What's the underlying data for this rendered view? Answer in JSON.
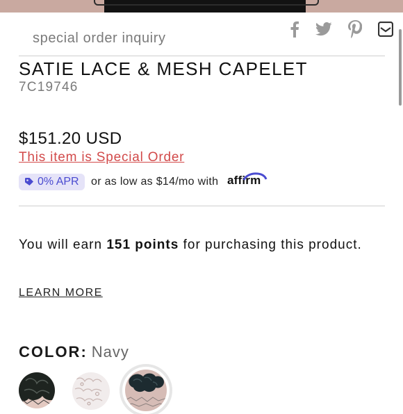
{
  "page": {
    "inquiry_label": "special order inquiry",
    "share_icons": [
      "facebook-icon",
      "twitter-icon",
      "pinterest-icon",
      "email-icon"
    ]
  },
  "product": {
    "title": "SATIE LACE & MESH CAPELET",
    "sku": "7C19746",
    "price": "$151.20 USD",
    "special_order": "This item is Special Order"
  },
  "financing": {
    "apr_badge": "0% APR",
    "text": "or as low as $14/mo with",
    "brand": "affirm",
    "brand_color": "#4a4bd0"
  },
  "rewards": {
    "prefix": "You will earn",
    "points": "151 points",
    "suffix": "for purchasing this product.",
    "learn_more": "LEARN MORE"
  },
  "color": {
    "label": "COLOR:",
    "selected": "Navy",
    "swatches": [
      "Black",
      "White",
      "Navy"
    ]
  },
  "accent": {
    "special_order": "#d24a4a",
    "apr_bg": "#e5e3f8"
  }
}
